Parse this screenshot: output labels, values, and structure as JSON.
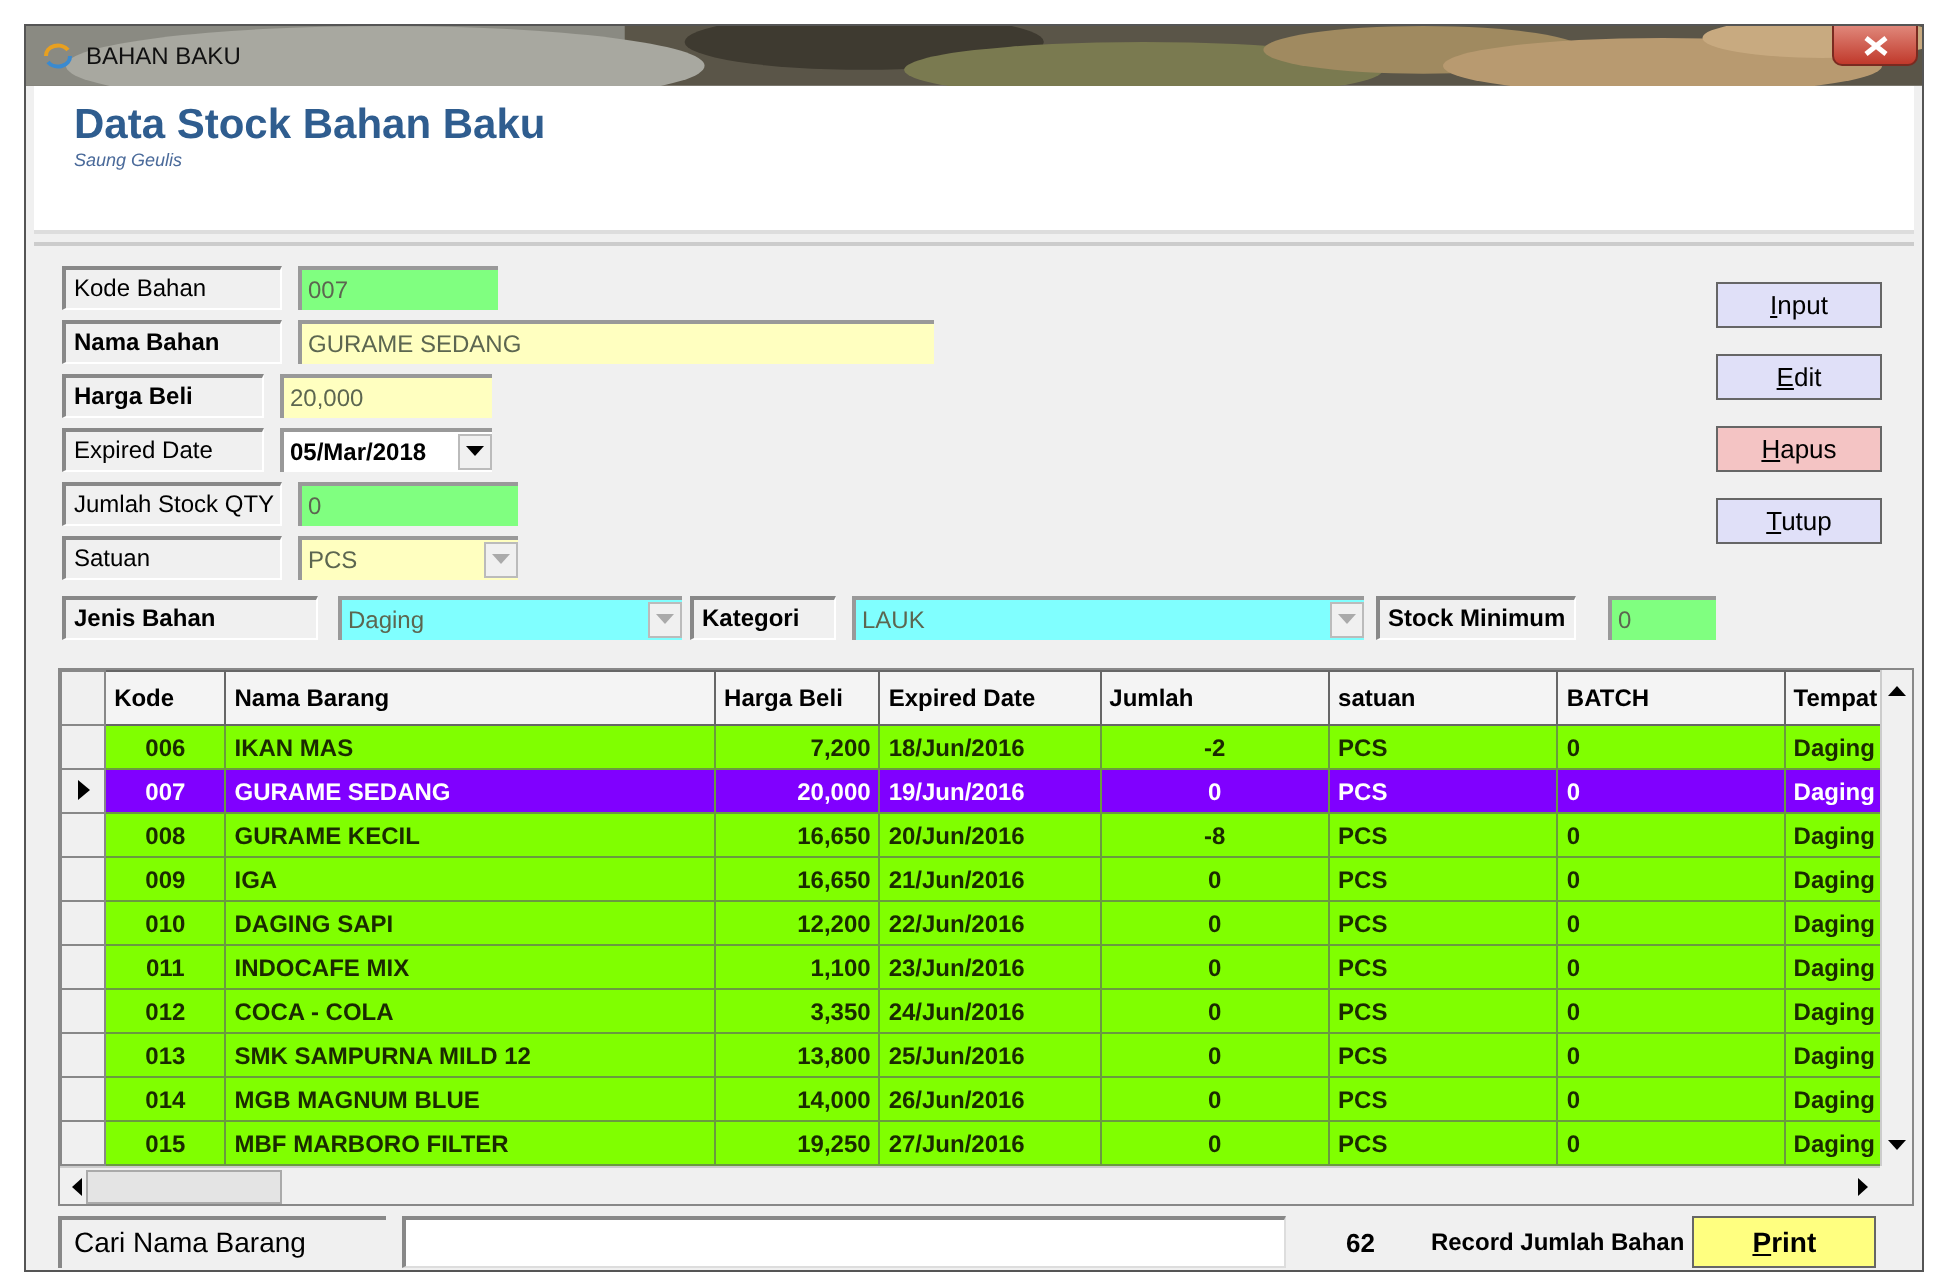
{
  "window": {
    "title": "BAHAN BAKU"
  },
  "header": {
    "title": "Data Stock Bahan Baku",
    "subtitle": "Saung Geulis"
  },
  "form": {
    "fields": [
      {
        "label": "Kode Bahan",
        "value": "007",
        "kind": "text",
        "color": "#80ff80",
        "emphasis": false
      },
      {
        "label": "Nama Bahan",
        "value": "GURAME SEDANG",
        "kind": "text",
        "color": "#ffffc0",
        "emphasis": true
      },
      {
        "label": "Harga Beli",
        "value": "20,000",
        "kind": "text",
        "color": "#ffffc0",
        "emphasis": true
      },
      {
        "label": "Expired Date",
        "value": "05/Mar/2018",
        "kind": "date",
        "color": "#ffffff",
        "emphasis": false
      },
      {
        "label": "Jumlah Stock QTY",
        "value": "0",
        "kind": "text",
        "color": "#80ff80",
        "emphasis": false
      },
      {
        "label": "Satuan",
        "value": "PCS",
        "kind": "combo",
        "color": "#ffffc0",
        "emphasis": false
      }
    ],
    "filters": [
      {
        "label": "Jenis Bahan",
        "value": "Daging",
        "kind": "combo",
        "color": "#80ffff"
      },
      {
        "label": "Kategori",
        "value": "LAUK",
        "kind": "combo",
        "color": "#80ffff"
      },
      {
        "label": "Stock Minimum",
        "value": "0",
        "kind": "text",
        "color": "#80ff80"
      }
    ]
  },
  "buttons": [
    {
      "label": "Input",
      "color": "#e0e0f8"
    },
    {
      "label": "Edit",
      "color": "#e0e0f8"
    },
    {
      "label": "Hapus",
      "color": "#f4c4c4"
    },
    {
      "label": "Tutup",
      "color": "#e0e0f8"
    }
  ],
  "table": {
    "columns": [
      "Kode",
      "Nama Barang",
      "Harga Beli",
      "Expired Date",
      "Jumlah",
      "satuan",
      "BATCH",
      "Tempat"
    ],
    "rows": [
      {
        "cells": [
          "006",
          "IKAN MAS",
          "7,200",
          "18/Jun/2016",
          "-2",
          "PCS",
          "0",
          "Daging"
        ],
        "selected": false
      },
      {
        "cells": [
          "007",
          "GURAME SEDANG",
          "20,000",
          "19/Jun/2016",
          "0",
          "PCS",
          "0",
          "Daging"
        ],
        "selected": true
      },
      {
        "cells": [
          "008",
          "GURAME KECIL",
          "16,650",
          "20/Jun/2016",
          "-8",
          "PCS",
          "0",
          "Daging"
        ],
        "selected": false
      },
      {
        "cells": [
          "009",
          "IGA",
          "16,650",
          "21/Jun/2016",
          "0",
          "PCS",
          "0",
          "Daging"
        ],
        "selected": false
      },
      {
        "cells": [
          "010",
          "DAGING SAPI",
          "12,200",
          "22/Jun/2016",
          "0",
          "PCS",
          "0",
          "Daging"
        ],
        "selected": false
      },
      {
        "cells": [
          "011",
          "INDOCAFE MIX",
          "1,100",
          "23/Jun/2016",
          "0",
          "PCS",
          "0",
          "Daging"
        ],
        "selected": false
      },
      {
        "cells": [
          "012",
          "COCA - COLA",
          "3,350",
          "24/Jun/2016",
          "0",
          "PCS",
          "0",
          "Daging"
        ],
        "selected": false
      },
      {
        "cells": [
          "013",
          "SMK SAMPURNA MILD 12",
          "13,800",
          "25/Jun/2016",
          "0",
          "PCS",
          "0",
          "Daging"
        ],
        "selected": false
      },
      {
        "cells": [
          "014",
          "MGB MAGNUM BLUE",
          "14,000",
          "26/Jun/2016",
          "0",
          "PCS",
          "0",
          "Daging"
        ],
        "selected": false
      },
      {
        "cells": [
          "015",
          "MBF MARBORO FILTER",
          "19,250",
          "27/Jun/2016",
          "0",
          "PCS",
          "0",
          "Daging"
        ],
        "selected": false
      }
    ]
  },
  "footer": {
    "search_label": "Cari Nama Barang",
    "count": "62",
    "count_label": "Record Jumlah Bahan",
    "print": {
      "label": "Print"
    }
  }
}
